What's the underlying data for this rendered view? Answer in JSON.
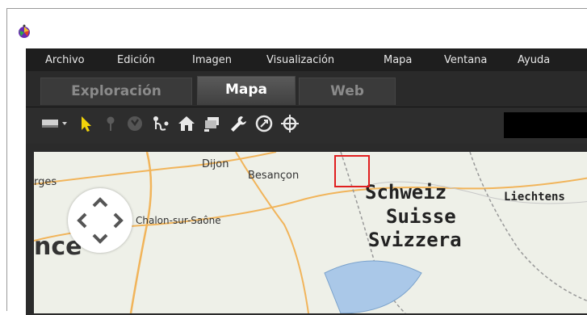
{
  "menu": [
    "Archivo",
    "Edición",
    "Imagen",
    "Visualización",
    "Mapa",
    "Ventana",
    "Ayuda"
  ],
  "tabs": [
    {
      "label": "Exploración",
      "active": false
    },
    {
      "label": "Mapa",
      "active": true
    },
    {
      "label": "Web",
      "active": false
    }
  ],
  "toolbar": {
    "icons": [
      "view-mode-icon",
      "pointer-icon",
      "pin-icon",
      "track-icon",
      "route-icon",
      "home-icon",
      "slideshow-icon",
      "settings-wrench-icon",
      "gps-icon",
      "crosshair-icon"
    ],
    "highlighted": "settings-wrench-icon",
    "highlight_color": "#e01f1f"
  },
  "map": {
    "places": [
      "Dijon",
      "Besançon",
      "Chalon-sur-Saône",
      "Schweiz",
      "Suisse",
      "Svizzera",
      "Liechtens",
      "rges",
      "nce"
    ]
  }
}
